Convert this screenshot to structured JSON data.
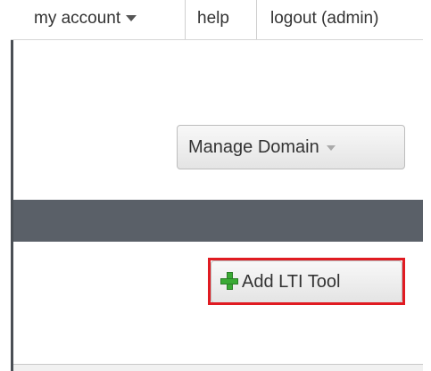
{
  "topnav": {
    "my_account_label": "my account",
    "help_label": "help",
    "logout_label": "logout (admin)"
  },
  "actions": {
    "manage_domain_label": "Manage Domain",
    "add_lti_tool_label": "Add LTI Tool"
  },
  "colors": {
    "header_band": "#5a6068",
    "highlight": "#e01b22",
    "plus_icon": "#3aaa35"
  },
  "icons": {
    "account_menu": "caret-down-icon",
    "manage_menu": "caret-down-icon",
    "add_tool": "plus-icon"
  }
}
